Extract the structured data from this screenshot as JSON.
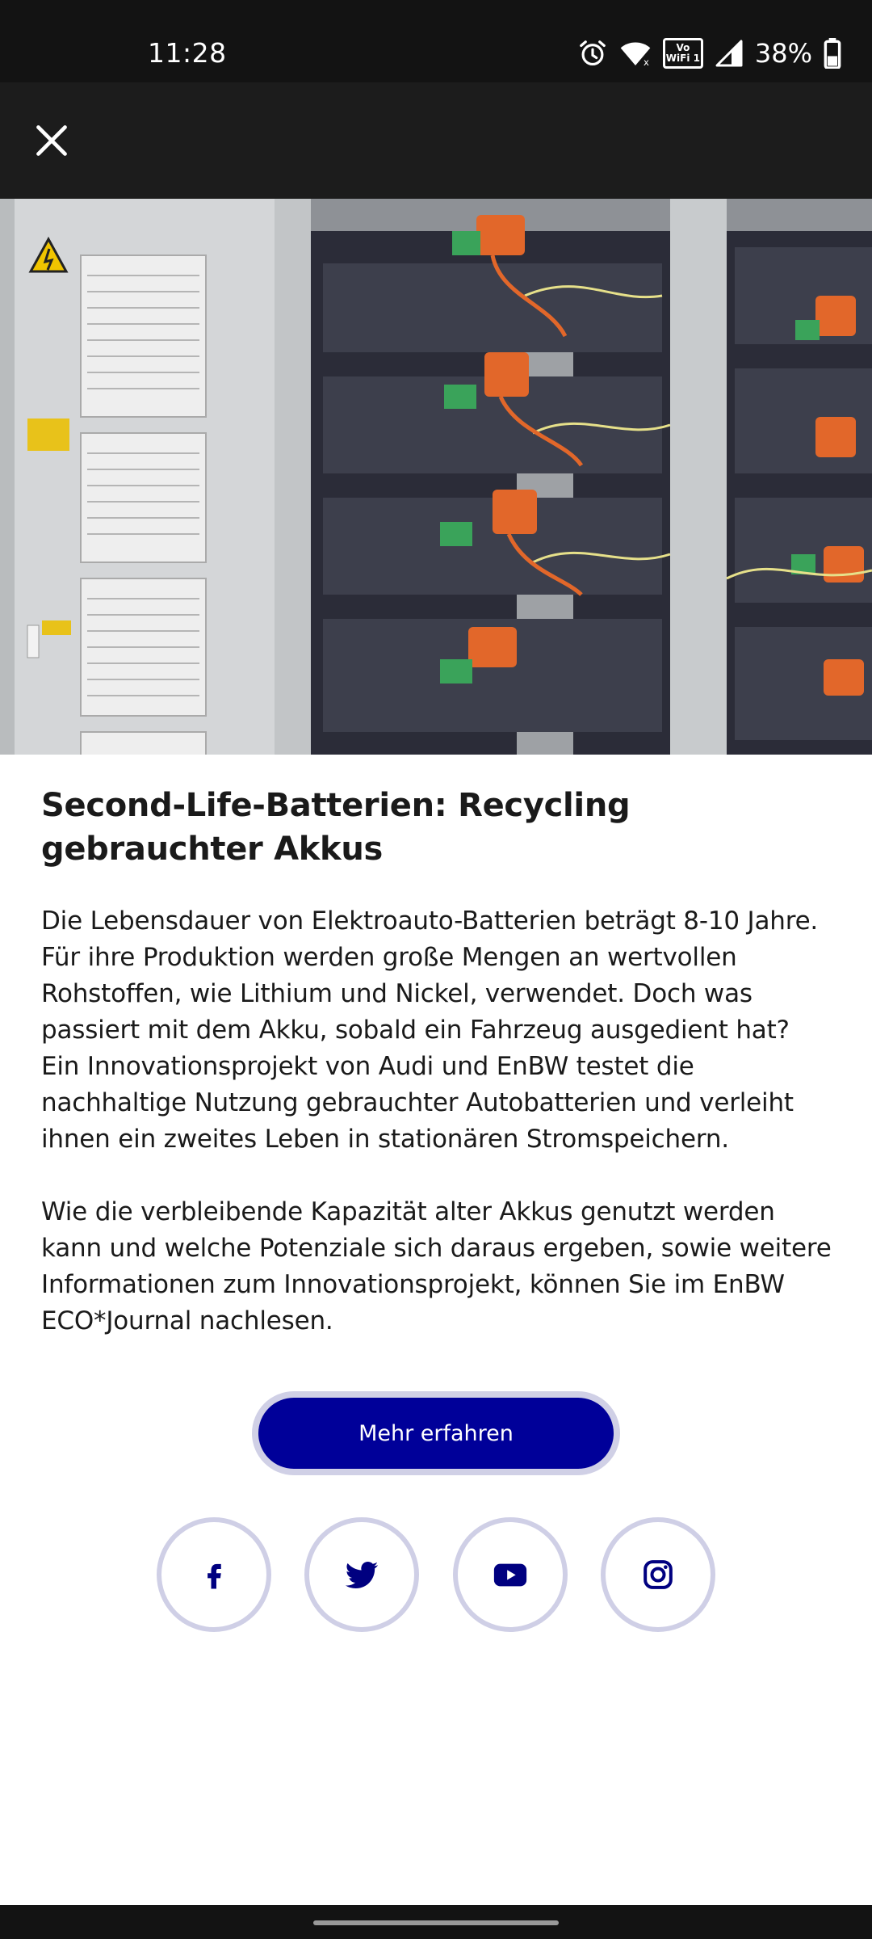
{
  "status_bar": {
    "time": "11:28",
    "vowifi_top": "Vo",
    "vowifi_bottom": "WiFi 1",
    "battery_percent": "38%",
    "icons": [
      "alarm-icon",
      "wifi-icon",
      "vowifi-icon",
      "signal-icon",
      "battery-icon"
    ]
  },
  "app_bar": {
    "close_icon": "close-icon"
  },
  "hero": {
    "image": "battery-storage-racks-photo"
  },
  "article": {
    "title": "Second-Life-Batterien: Recycling gebrauchter Akkus",
    "paragraph_1": "Die Lebensdauer von Elektroauto-Batterien beträgt 8-10 Jahre. Für ihre Produktion werden große Mengen an wertvollen Rohstoffen, wie Lithium und Nickel, verwendet. Doch was passiert mit dem Akku, sobald ein Fahrzeug ausgedient hat? Ein Innovationsprojekt von Audi und EnBW testet die nachhaltige Nutzung gebrauchter Autobatterien und verleiht ihnen ein zweites Leben in stationären Stromspeichern.",
    "paragraph_2": "Wie die verbleibende Kapazität alter Akkus genutzt werden kann und welche Potenziale sich daraus ergeben, sowie weitere Informationen zum Innovationsprojekt, können Sie im EnBW ECO*Journal nachlesen."
  },
  "cta": {
    "label": "Mehr erfahren",
    "color": "#000099"
  },
  "social": {
    "icons": [
      "facebook-icon",
      "twitter-icon",
      "youtube-icon",
      "instagram-icon"
    ],
    "icon_color": "#000080",
    "ring_color": "#cfcfe6"
  }
}
